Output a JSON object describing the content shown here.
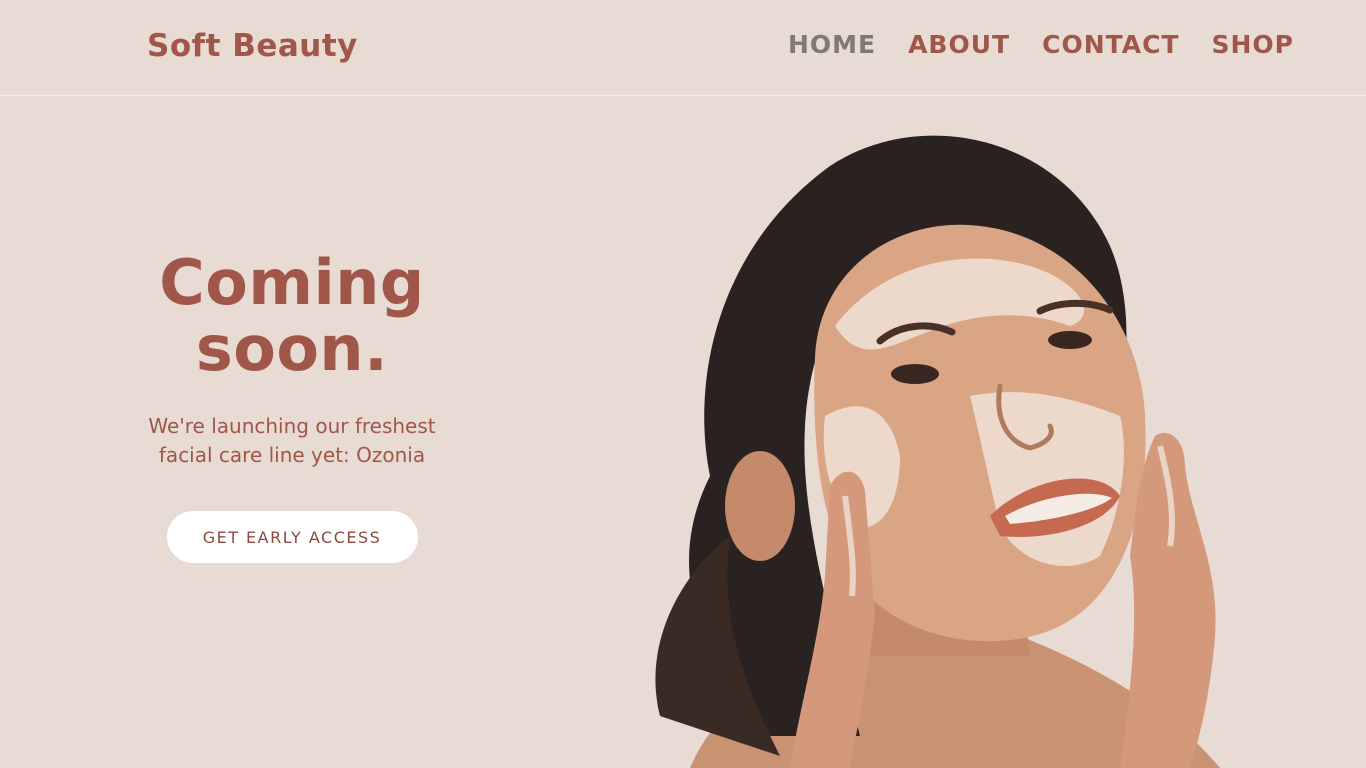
{
  "brand": {
    "name": "Soft Beauty"
  },
  "nav": {
    "items": [
      {
        "label": "HOME"
      },
      {
        "label": "ABOUT"
      },
      {
        "label": "CONTACT"
      },
      {
        "label": "SHOP"
      }
    ]
  },
  "hero": {
    "title_line1": "Coming",
    "title_line2": "soon.",
    "subtitle_line1": "We're launching our freshest",
    "subtitle_line2": "facial care line yet: Ozonia",
    "cta_label": "GET EARLY ACCESS"
  },
  "colors": {
    "background": "#e8dbd3",
    "accent": "#a0574a",
    "nav_active": "#7d7a78",
    "button_bg": "#ffffff"
  }
}
